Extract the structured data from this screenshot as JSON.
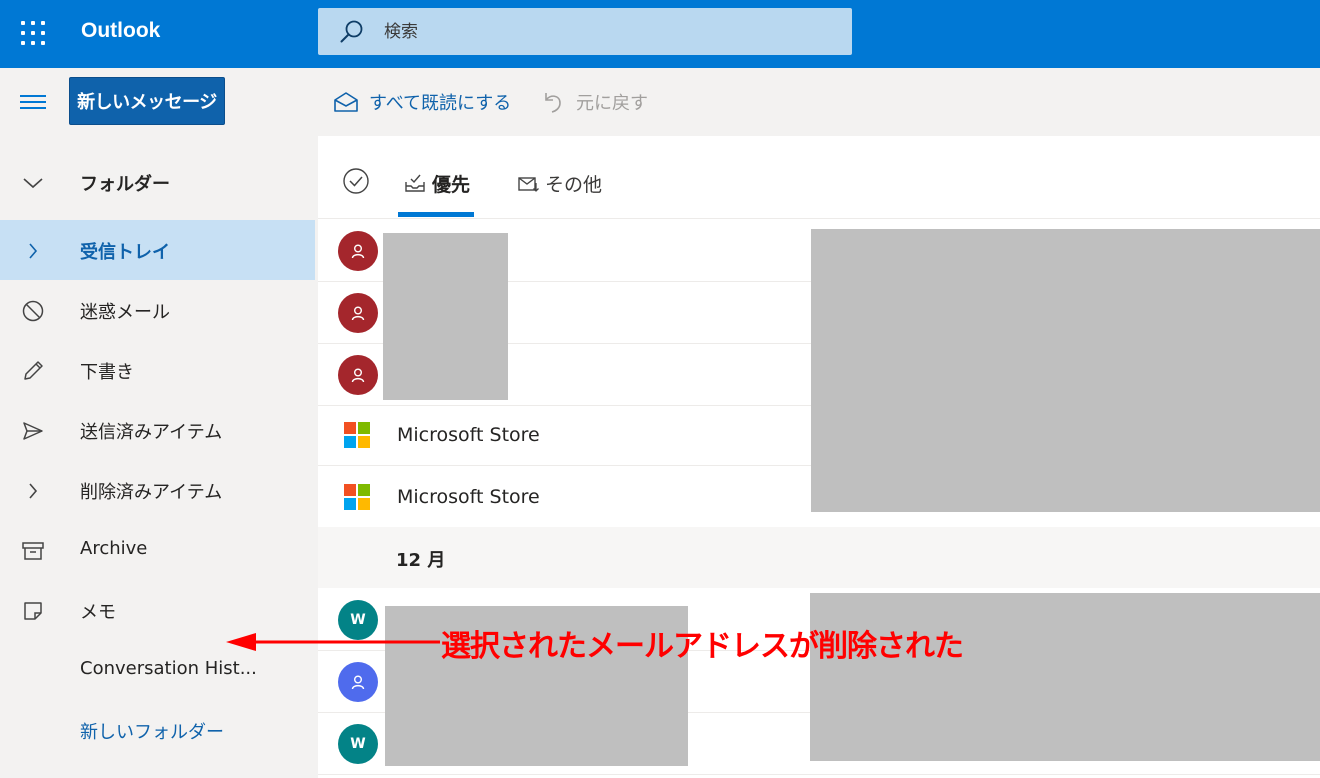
{
  "app": {
    "brand": "Outlook",
    "search_placeholder": "検索"
  },
  "toolbar": {
    "new_message": "新しいメッセージ",
    "mark_all_read": "すべて既読にする",
    "undo": "元に戻す"
  },
  "sidebar": {
    "folders_header": "フォルダー",
    "items": [
      {
        "label": "受信トレイ",
        "icon": "chevron-right-icon",
        "selected": true
      },
      {
        "label": "迷惑メール",
        "icon": "block-icon"
      },
      {
        "label": "下書き",
        "icon": "pencil-icon"
      },
      {
        "label": "送信済みアイテム",
        "icon": "send-icon"
      },
      {
        "label": "削除済みアイテム",
        "icon": "chevron-right-icon"
      },
      {
        "label": "Archive",
        "icon": "archive-icon"
      },
      {
        "label": "メモ",
        "icon": "note-icon"
      },
      {
        "label": "Conversation Hist..."
      },
      {
        "label": "新しいフォルダー",
        "link": true
      }
    ]
  },
  "tabs": {
    "focused": "優先",
    "other": "その他"
  },
  "messages": {
    "row1": {
      "avatar": "person-icon",
      "color": "#a4262c"
    },
    "row2": {
      "avatar": "person-icon",
      "color": "#a4262c"
    },
    "row3": {
      "avatar": "person-icon",
      "color": "#a4262c"
    },
    "row4": {
      "sender": "Microsoft Store"
    },
    "row5": {
      "sender": "Microsoft Store"
    },
    "group_header": "12 月",
    "row6": {
      "initial": "W",
      "color": "#038387"
    },
    "row7": {
      "avatar": "person-icon",
      "color": "#4f6bed"
    },
    "row8": {
      "initial": "W",
      "color": "#038387"
    }
  },
  "annotation": {
    "text": "選択されたメールアドレスが削除された",
    "color": "#ff0000"
  }
}
